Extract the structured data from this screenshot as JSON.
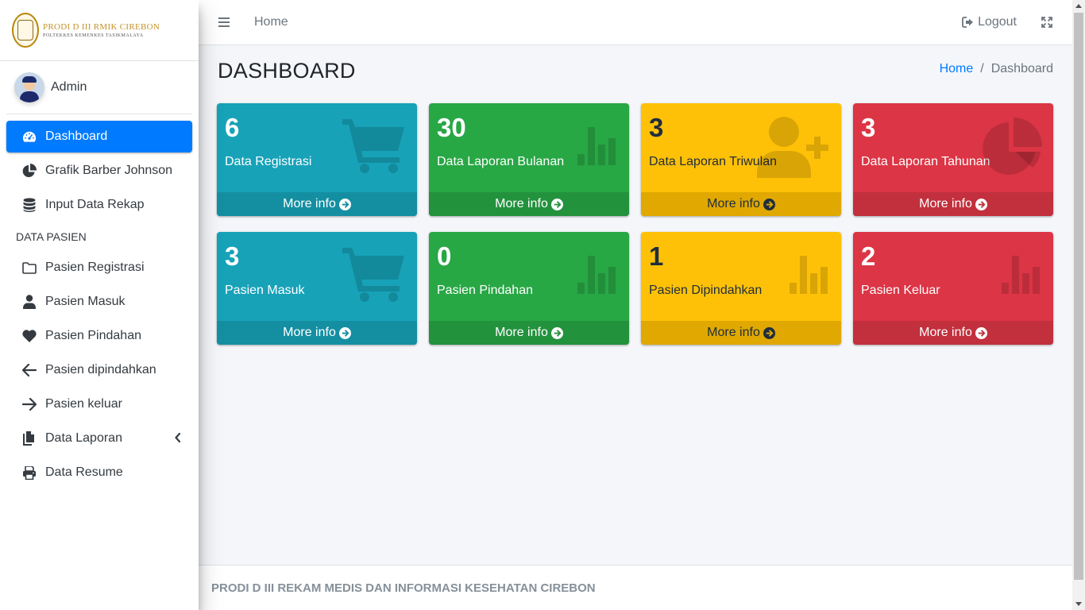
{
  "brand": {
    "title": "PRODI D III RMIK CIREBON",
    "subtitle": "POLTEKKES KEMENKES TASIKMALAYA"
  },
  "user": {
    "name": "Admin"
  },
  "sidebar": {
    "items": [
      {
        "label": "Dashboard",
        "icon": "tachometer-icon",
        "active": true
      },
      {
        "label": "Grafik Barber Johnson",
        "icon": "chart-pie-icon"
      },
      {
        "label": "Input Data Rekap",
        "icon": "database-icon"
      }
    ],
    "section_header": "DATA PASIEN",
    "patient_items": [
      {
        "label": "Pasien Registrasi",
        "icon": "folder-icon"
      },
      {
        "label": "Pasien Masuk",
        "icon": "user-icon"
      },
      {
        "label": "Pasien Pindahan",
        "icon": "heart-icon"
      },
      {
        "label": "Pasien dipindahkan",
        "icon": "arrow-left-icon"
      },
      {
        "label": "Pasien keluar",
        "icon": "arrow-right-icon"
      },
      {
        "label": "Data Laporan",
        "icon": "copy-icon",
        "has_submenu": true
      },
      {
        "label": "Data Resume",
        "icon": "print-icon"
      }
    ]
  },
  "topbar": {
    "home": "Home",
    "logout": "Logout"
  },
  "page": {
    "title": "DASHBOARD",
    "breadcrumb_home": "Home",
    "breadcrumb_separator": "/",
    "breadcrumb_current": "Dashboard"
  },
  "boxes": [
    {
      "value": "6",
      "label": "Data Registrasi",
      "color": "#17a2b8",
      "icon": "shopping-cart-icon",
      "more": "More info"
    },
    {
      "value": "30",
      "label": "Data Laporan Bulanan",
      "color": "#28a745",
      "icon": "bar-chart-icon",
      "more": "More info"
    },
    {
      "value": "3",
      "label": "Data Laporan Triwulan",
      "color": "#ffc107",
      "icon": "user-plus-icon",
      "more": "More info"
    },
    {
      "value": "3",
      "label": "Data Laporan Tahunan",
      "color": "#dc3545",
      "icon": "pie-chart-icon",
      "more": "More info"
    },
    {
      "value": "3",
      "label": "Pasien Masuk",
      "color": "#17a2b8",
      "icon": "shopping-cart-icon",
      "more": "More info"
    },
    {
      "value": "0",
      "label": "Pasien Pindahan",
      "color": "#28a745",
      "icon": "bar-chart-icon",
      "more": "More info"
    },
    {
      "value": "1",
      "label": "Pasien Dipindahkan",
      "color": "#ffc107",
      "icon": "bar-chart-icon",
      "more": "More info"
    },
    {
      "value": "2",
      "label": "Pasien Keluar",
      "color": "#dc3545",
      "icon": "bar-chart-icon",
      "more": "More info"
    }
  ],
  "footer": {
    "text": "PRODI D III REKAM MEDIS DAN INFORMASI KESEHATAN CIREBON"
  }
}
